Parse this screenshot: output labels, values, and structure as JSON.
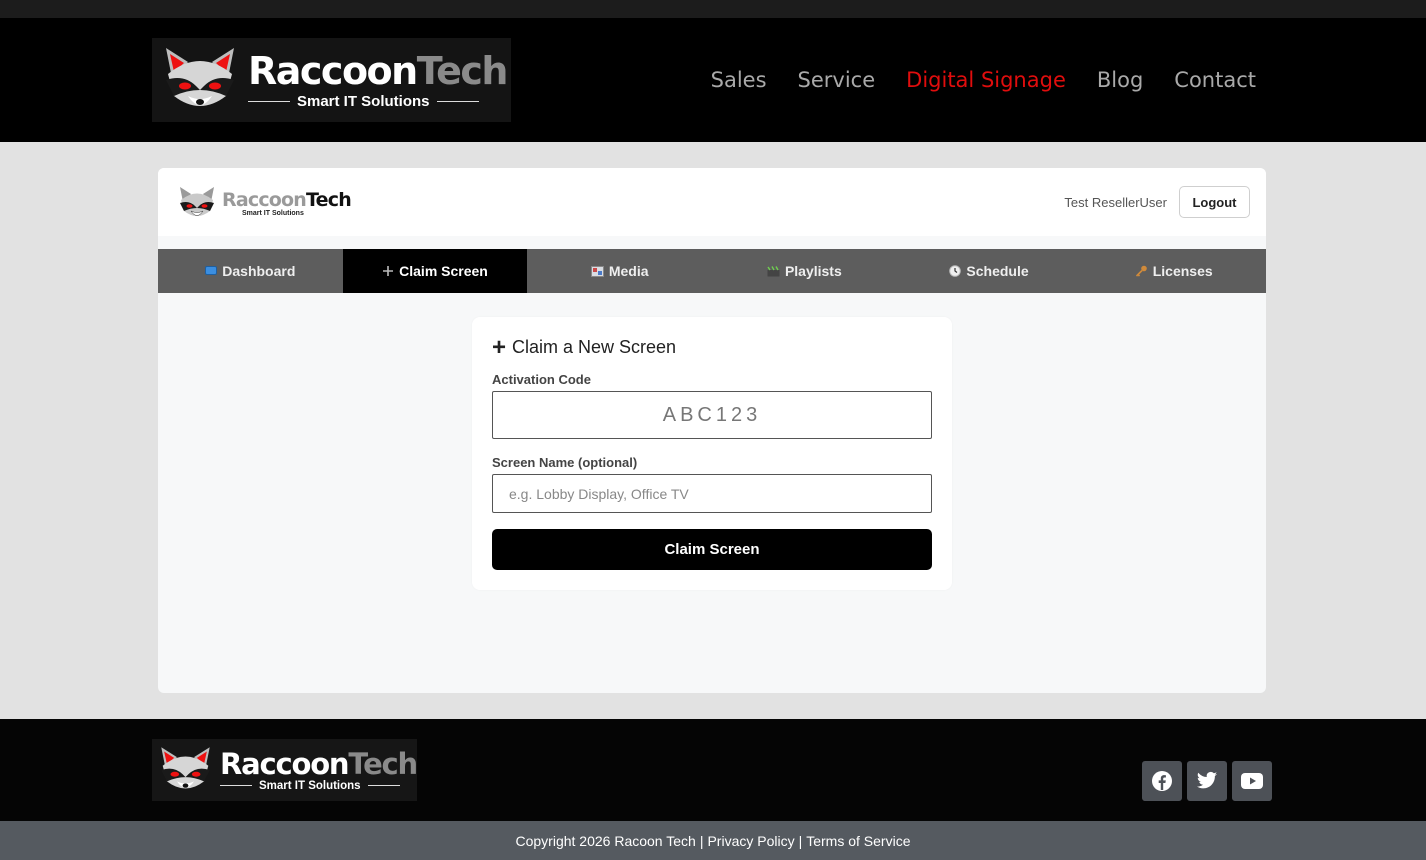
{
  "brand": {
    "name_part1": "Raccoon",
    "name_part2": "Tech",
    "tagline": "Smart IT Solutions",
    "logo_icon": "raccoon-face-icon"
  },
  "nav": {
    "items": [
      {
        "label": "Sales"
      },
      {
        "label": "Service"
      },
      {
        "label": "Digital Signage",
        "active": true
      },
      {
        "label": "Blog"
      },
      {
        "label": "Contact"
      }
    ]
  },
  "app": {
    "user_name": "Test ResellerUser",
    "logout_label": "Logout",
    "tabs": [
      {
        "label": "Dashboard",
        "icon": "monitor-icon"
      },
      {
        "label": "Claim Screen",
        "icon": "plus-icon",
        "active": true
      },
      {
        "label": "Media",
        "icon": "image-icon"
      },
      {
        "label": "Playlists",
        "icon": "clapperboard-icon"
      },
      {
        "label": "Schedule",
        "icon": "clock-icon"
      },
      {
        "label": "Licenses",
        "icon": "key-icon"
      }
    ]
  },
  "claim": {
    "title": "Claim a New Screen",
    "activation_label": "Activation Code",
    "activation_placeholder": "ABC123",
    "activation_value": "",
    "name_label": "Screen Name (optional)",
    "name_placeholder": "e.g. Lobby Display, Office TV",
    "name_value": "",
    "submit_label": "Claim Screen"
  },
  "footer": {
    "social": [
      "facebook-icon",
      "twitter-icon",
      "youtube-icon"
    ],
    "copyright": "Copyright 2026 Racoon Tech",
    "separator": "|",
    "privacy_label": "Privacy Policy",
    "terms_label": "Terms of Service"
  },
  "colors": {
    "accent_red": "#e00d0d",
    "header_bg": "#000000",
    "tab_bar": "#5d5d5d",
    "footer_bar": "#555a60"
  }
}
